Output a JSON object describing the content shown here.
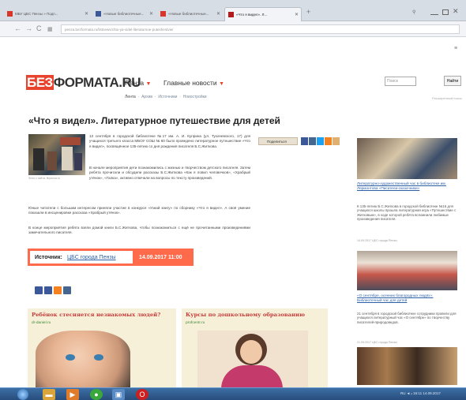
{
  "browser": {
    "tabs": [
      {
        "label": "МБУ ЦБС Пензы » Подп...",
        "favicon": "#d9362b"
      },
      {
        "label": "«Новые библиотечные...",
        "favicon": "#3b5998"
      },
      {
        "label": "«Новые библиотечные...",
        "favicon": "#d9362b"
      },
      {
        "label": "«Что я видел». Л...",
        "favicon": "#b31b1b",
        "active": true
      }
    ],
    "url": "penza.bezformata.ru/listnews/chto-ya-videl-literaturnoe-puteshestvie/"
  },
  "site": {
    "logo_prefix": "БЕЗ",
    "logo_rest": "ФОРМАТА.RU",
    "nav": [
      "Пенза",
      "Главные новости"
    ],
    "subnav": [
      "Лента",
      "Архив",
      "Источники",
      "Новостройки"
    ],
    "search_placeholder": "Поиск",
    "search_button": "Найти",
    "advanced_search": "Расширенный поиск"
  },
  "article": {
    "title": "«Что я видел». Литературное путешествие для детей",
    "photo_caption": "Фото с сайта: libpenza.ru",
    "p1": "13 сентября в городской библиотеке №17 им. А. И. Куприна (ул. Тухачевского, 17) для учащихся третьего класса МБОУ СОШ № 60 было проведено литературное путешествие «Что я видел», посвящённое 135-летию со дня рождения писателя Б.С.Житкова.",
    "p2": "В начале мероприятия дети познакомились с жизнью и творчеством детского писателя. Затем ребята прочитали и обсудили рассказы Б.С.Житкова «Как я ловил человечков», «Храбрый утёнок», «Галка», активно отвечали на вопросы по тексту произведений.",
    "p3": "Юные читатели с большим интересом приняли участие в конкурсе «Узнай книгу» по сборнику «Что я видел». А своё умение показали в инсценировке рассказа «Храбрый утёнок».",
    "p4": "В конце мероприятия ребята взяли домой книги Б.С.Житкова, чтобы познакомиться с ещё не прочитанными произведениями замечательного писателя.",
    "share_label": "Поделиться",
    "source_label": "Источник:",
    "source_link": "ЦБС города Пензы",
    "source_date": "14.09.2017 11:00"
  },
  "social_colors": [
    "#3b5998",
    "#3b5998",
    "#f58220",
    "#45668e"
  ],
  "ads": [
    {
      "title": "Ребёнок стесняется незнакомых людей?",
      "site": "dr-daniel.ru"
    },
    {
      "title": "Курсы по дошкольному образованию",
      "site": "profcentr.ru"
    }
  ],
  "sidebar": [
    {
      "link": "Литературно-художественный час в библиотеке им. Лермонтова «Писатели-сказочники»",
      "text": "",
      "date": ""
    },
    {
      "link": "",
      "text": "К 135-летию Б.С.Житкова в городской библиотеке №16 для учащихся школы прошла литературная игра «Путешествие с Житковым», в ходе которой ребята вспомнили любимые произведения писателя.",
      "date": "14.09.2017 ЦБС города Пензы"
    },
    {
      "link": "«О сентябре, осенних благородных людях». Библиотечный час для детей",
      "text": "21 сентября в городской библиотеке сотрудники провели для учащихся литературный час «О сентябре» по творчеству писателей-природоведов.",
      "date": "21.09.2017 ЦБС города Пензы"
    }
  ],
  "taskbar": {
    "tray": "RU  ◄  ᵢₗ  16:11  14.09.2017"
  }
}
